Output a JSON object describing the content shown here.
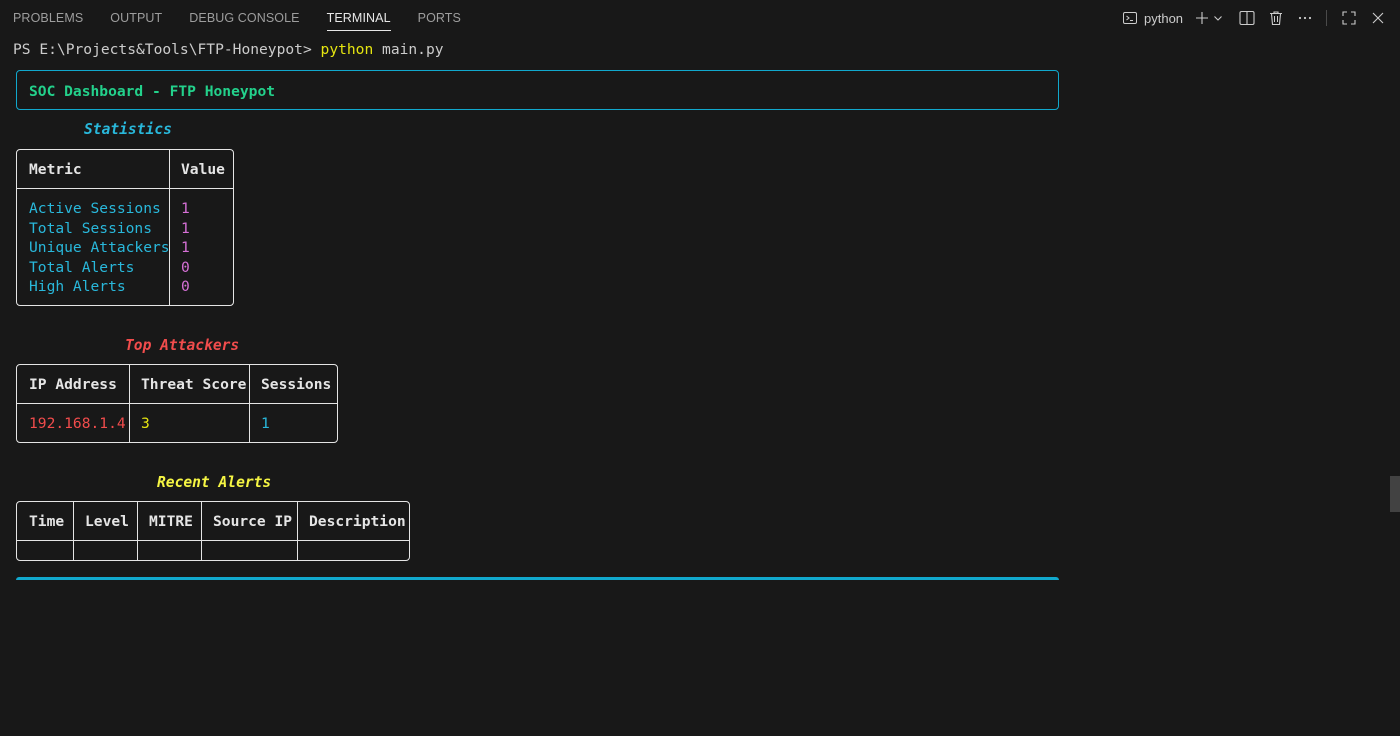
{
  "panel": {
    "tabs": [
      {
        "label": "PROBLEMS"
      },
      {
        "label": "OUTPUT"
      },
      {
        "label": "DEBUG CONSOLE"
      },
      {
        "label": "TERMINAL"
      },
      {
        "label": "PORTS"
      }
    ],
    "active_tab": "TERMINAL",
    "terminal_name": "python",
    "icons": [
      "terminal-icon",
      "plus-icon",
      "chevron-down-icon",
      "split-icon",
      "trash-icon",
      "more-icon",
      "maximize-icon",
      "close-icon"
    ]
  },
  "terminal": {
    "prompt": "PS E:\\Projects&Tools\\FTP-Honeypot> ",
    "command_program": "python",
    "command_args": " main.py"
  },
  "dashboard": {
    "title": "SOC Dashboard - FTP Honeypot",
    "statistics": {
      "caption": "Statistics",
      "headers": [
        "Metric",
        "Value"
      ],
      "rows": [
        {
          "metric": "Active Sessions",
          "value": "1"
        },
        {
          "metric": "Total Sessions",
          "value": "1"
        },
        {
          "metric": "Unique Attackers",
          "value": "1"
        },
        {
          "metric": "Total Alerts",
          "value": "0"
        },
        {
          "metric": "High Alerts",
          "value": "0"
        }
      ]
    },
    "top_attackers": {
      "caption": "Top Attackers",
      "headers": [
        "IP Address",
        "Threat Score",
        "Sessions"
      ],
      "rows": [
        {
          "ip": "192.168.1.4",
          "threat_score": "3",
          "sessions": "1"
        }
      ]
    },
    "recent_alerts": {
      "caption": "Recent Alerts",
      "headers": [
        "Time",
        "Level",
        "MITRE",
        "Source IP",
        "Description"
      ],
      "rows": []
    }
  },
  "colors": {
    "background": "#181818",
    "border_cyan": "#11a8cd",
    "title_green": "#23d18b",
    "metric_cyan": "#29b8db",
    "value_magenta": "#d670d6",
    "ip_red": "#f14c4c",
    "score_yellow": "#e5e510",
    "caption_yellow": "#f5f543"
  }
}
